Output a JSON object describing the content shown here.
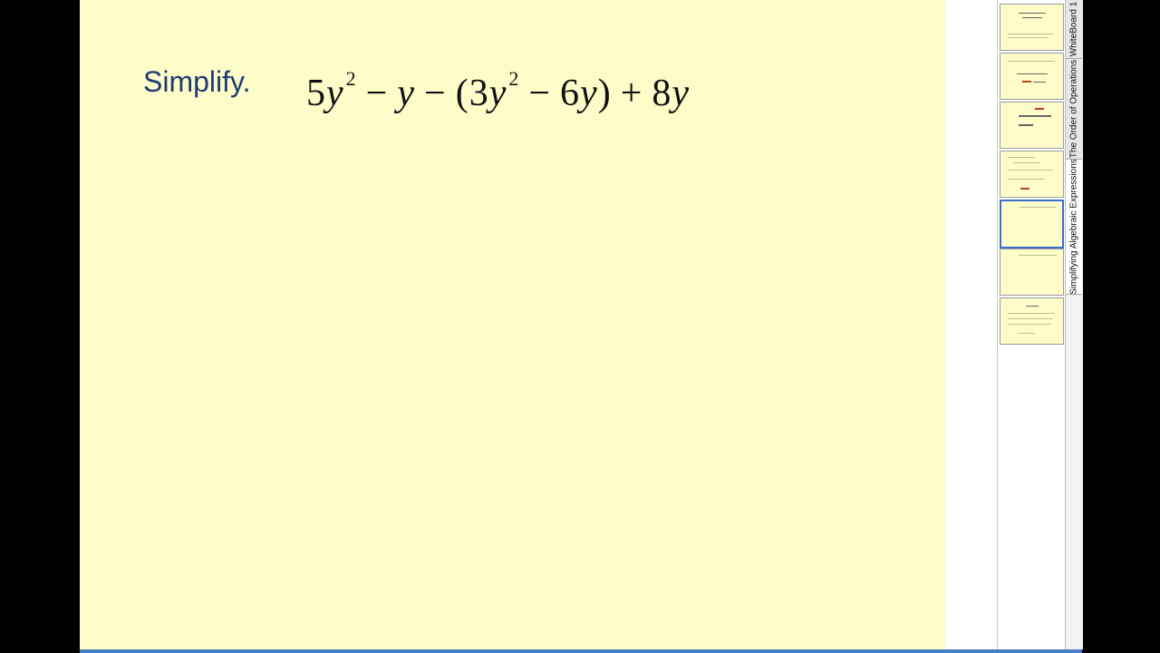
{
  "slide": {
    "title": "Simplify.",
    "expression": {
      "t1_coef": "5",
      "t1_var": "y",
      "t1_exp": "2",
      "op1": "−",
      "t2_var": "y",
      "op2": "−",
      "lparen": "(",
      "t3_coef": "3",
      "t3_var": "y",
      "t3_exp": "2",
      "op3": "−",
      "t4_coef": "6",
      "t4_var": "y",
      "rparen": ")",
      "op4": "+",
      "t5_coef": "8",
      "t5_var": "y"
    }
  },
  "tabs": [
    {
      "label": "WhiteBoard 1"
    },
    {
      "label": "The Order of Operations"
    },
    {
      "label": "Simplifying Algebraic Expressions"
    }
  ],
  "colors": {
    "slide_bg": "#fefdc9",
    "title": "#1f3b73",
    "thumb_selected": "#3a6fcf"
  }
}
